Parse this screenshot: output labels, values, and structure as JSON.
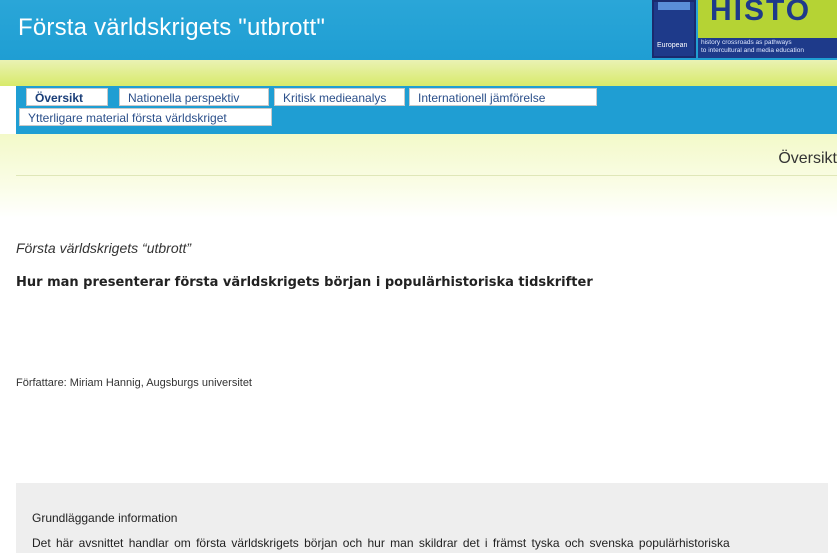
{
  "header": {
    "title": "Första världskrigets \"utbrott\"",
    "logo": {
      "letters": "HISTO",
      "european": "European",
      "tagline_line1": "history crossroads as pathways",
      "tagline_line2": "to intercultural and media education"
    }
  },
  "tabs": [
    {
      "label": "Översikt",
      "active": true
    },
    {
      "label": "Nationella perspektiv",
      "active": false
    },
    {
      "label": "Kritisk medieanalys",
      "active": false
    },
    {
      "label": "Internationell jämförelse",
      "active": false
    },
    {
      "label": "Ytterligare material första världskriget",
      "active": false
    }
  ],
  "breadcrumb": {
    "current": "Översikt"
  },
  "article": {
    "title": "Första världskrigets “utbrott”",
    "subtitle": "Hur man presenterar första världskrigets början i populärhistoriska tidskrifter",
    "author": "Författare: Miriam Hannig, Augsburgs universitet"
  },
  "info": {
    "heading": "Grundläggande information",
    "text": "Det här avsnittet handlar om första världskrigets början och hur man skildrar det i främst tyska och svenska populärhistoriska"
  },
  "colors": {
    "header_blue": "#1f9ed3",
    "lime": "#d8ea6a",
    "logo_green": "#b5d334",
    "logo_navy": "#1e3a8a"
  }
}
